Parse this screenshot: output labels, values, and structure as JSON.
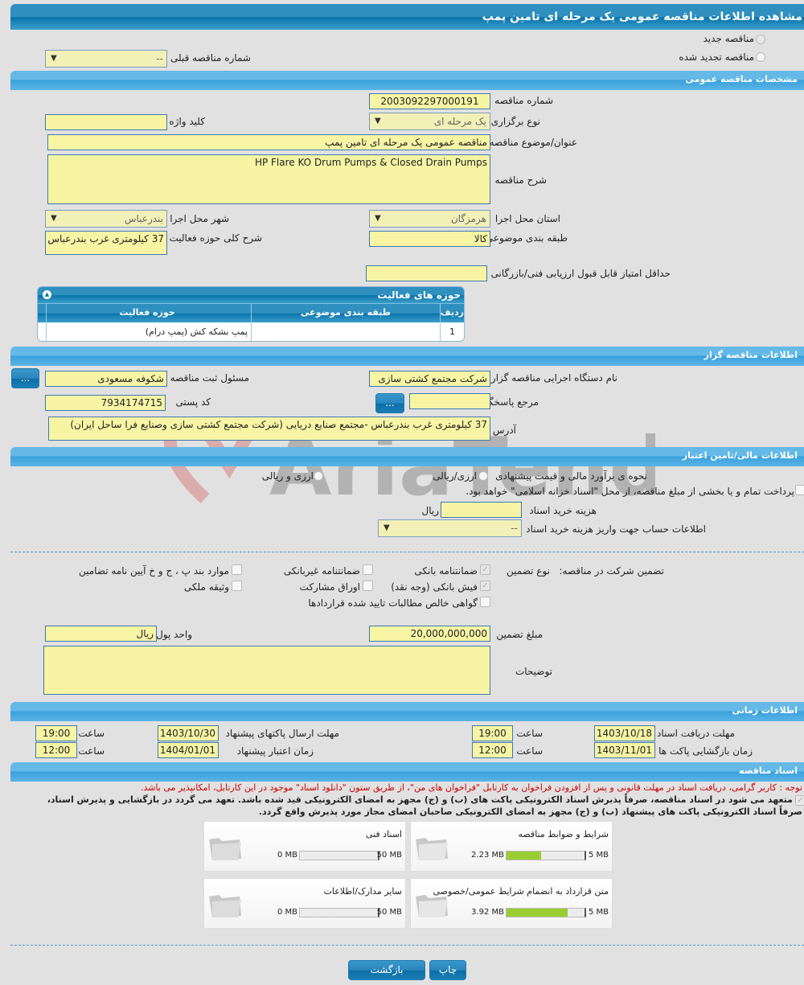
{
  "page_title": "مشاهده اطلاعات مناقصه عمومی یک مرحله ای تامین پمپ",
  "tender_type_options": [
    {
      "label": "مناقصه جدید",
      "selected": true
    },
    {
      "label": "مناقصه تجدید شده",
      "selected": false
    }
  ],
  "previous_tender": {
    "label": "شماره مناقصه قبلی",
    "value": "--"
  },
  "sections": {
    "general": "مشخصات مناقصه عمومی",
    "organizer": "اطلاعات مناقصه گزار",
    "financial": "اطلاعات مالی/تامین اعتبار",
    "timing": "اطلاعات زمانی",
    "documents": "اسناد مناقصه"
  },
  "general": {
    "tender_number_label": "شماره مناقصه",
    "tender_number": "2003092297000191",
    "holding_type_label": "نوع برگزاری",
    "holding_type": "یک مرحله ای",
    "keyword_label": "کلید واژه",
    "keyword": "",
    "subject_label": "عنوان/موضوع مناقصه",
    "subject": "مناقصه عمومی یک مرحله ای تامین پمپ",
    "description_label": "شرح مناقصه",
    "description": "HP Flare KO Drum Pumps & Closed Drain Pumps",
    "province_label": "استان محل اجرا",
    "province": "هرمزگان",
    "city_label": "شهر محل اجرا",
    "city": "بندرعباس",
    "category_label": "طبقه بندی موضوعی",
    "category": "کالا",
    "scope_label": "شرح کلی حوزه فعالیت",
    "scope": "37 کیلومتری غرب بندرعباس",
    "min_score_label": "حداقل امتیاز قابل قبول ارزیابی فنی/بازرگانی",
    "min_score": ""
  },
  "activity_table": {
    "title": "حوزه های فعالیت",
    "columns": [
      "ردیف",
      "طبقه بندی موضوعی",
      "حوزه فعالیت"
    ],
    "rows": [
      [
        "1",
        "",
        "پمپ بشکه کش (پمپ درام)"
      ]
    ]
  },
  "organizer": {
    "org_name_label": "نام دستگاه اجرایی مناقصه گزار",
    "org_name": "شرکت مجتمع کشتی سازی",
    "registrar_label": "مسئول ثبت مناقصه",
    "registrar": "شکوفه مسعودی",
    "reference_label": "مرجع پاسخگویی",
    "reference": "",
    "postal_label": "کد پستی",
    "postal": "7934174715",
    "address_label": "آدرس",
    "address": "37 کیلومتری غرب بندرعباس -مجتمع صنایع دریایی (شرکت مجتمع کشتی سازی وصنایع فرا ساحل ایران)",
    "more_button": "..."
  },
  "financial": {
    "estimate_label": "نحوه ی برآورد مالی و قیمت پیشنهادی",
    "estimate_options": [
      "ارزی/ریالی",
      "ارزی و ریالی"
    ],
    "treasury_text": "پرداخت تمام و یا بخشی از مبلغ مناقصه، از محل \"اسناد خزانه اسلامی\" خواهد بود.",
    "doc_cost_label": "هزینه خرید اسناد",
    "doc_cost": "",
    "doc_cost_unit": "ریال",
    "account_label": "اطلاعات حساب جهت واریز هزینه خرید اسناد",
    "account": "--"
  },
  "guarantee": {
    "label": "تضمین شرکت در مناقصه:",
    "type_label": "نوع تضمین",
    "options": [
      {
        "label": "ضمانتنامه بانکی",
        "checked": true
      },
      {
        "label": "ضمانتنامه غیربانکی",
        "checked": false
      },
      {
        "label": "موارد بند پ ، ج و خ آیین نامه تضامین",
        "checked": false
      },
      {
        "label": "فیش بانکی (وجه نقد)",
        "checked": true
      },
      {
        "label": "اوراق مشارکت",
        "checked": false
      },
      {
        "label": "وثیقه ملکی",
        "checked": false
      },
      {
        "label": "گواهی خالص مطالبات تایید شده قراردادها",
        "checked": false
      }
    ],
    "amount_label": "مبلغ تضمین",
    "amount": "20,000,000,000",
    "currency_label": "واحد پول",
    "currency": "ریال",
    "notes_label": "توضیحات",
    "notes": ""
  },
  "timing": {
    "doc_deadline_label": "مهلت دریافت اسناد",
    "doc_deadline_date": "1403/10/18",
    "doc_deadline_time": "19:00",
    "submit_deadline_label": "مهلت ارسال پاکتهای پیشنهاد",
    "submit_deadline_date": "1403/10/30",
    "submit_deadline_time": "19:00",
    "opening_label": "زمان بازگشایی پاکت ها",
    "opening_date": "1403/11/01",
    "opening_time": "12:00",
    "validity_label": "زمان اعتبار پیشنهاد",
    "validity_date": "1404/01/01",
    "validity_time": "12:00",
    "time_label": "ساعت"
  },
  "documents": {
    "notice": "توجه : کاربر گرامی، دریافت اسناد در مهلت قانونی و پس از افزودن فراخوان به کارتابل \"فراخوان های من\"، از طریق ستون \"دانلود اسناد\" موجود در این کارتابل، امکانپذیر می باشد.",
    "commitment_line1": "متعهد می شود در اسناد مناقصه، صرفاً پذیرش اسناد الکترونیکی پاکت های (ب) و (ج) مجهز به امضای الکترونیکی قید شده باشد. تعهد می گردد در بازگشایی و پذیرش اسناد،",
    "commitment_line2": "صرفاً اسناد الکترونیکی پاکت های پیشنهاد (ب) و (ج) مجهز به امضای الکترونیکی صاحبان امضای مجاز مورد پذیرش واقع گردد.",
    "commitment_checked": true,
    "files": [
      {
        "title": "شرایط و ضوابط مناقصه",
        "used": "2.23 MB",
        "max": "5 MB",
        "fraction": 0.446
      },
      {
        "title": "اسناد فنی",
        "used": "0 MB",
        "max": "50 MB",
        "fraction": 0
      },
      {
        "title": "متن قرارداد به انضمام شرایط عمومی/خصوصی",
        "used": "3.92 MB",
        "max": "5 MB",
        "fraction": 0.784
      },
      {
        "title": "سایر مدارک/اطلاعات",
        "used": "0 MB",
        "max": "50 MB",
        "fraction": 0
      }
    ]
  },
  "footer": {
    "print": "چاپ",
    "back": "بازگشت"
  },
  "watermark": "AriaTender.neT",
  "colors": {
    "header": "#2f90c0",
    "input": "#f7f5a4",
    "progress": "#9acd32",
    "notice": "#cc0000"
  }
}
